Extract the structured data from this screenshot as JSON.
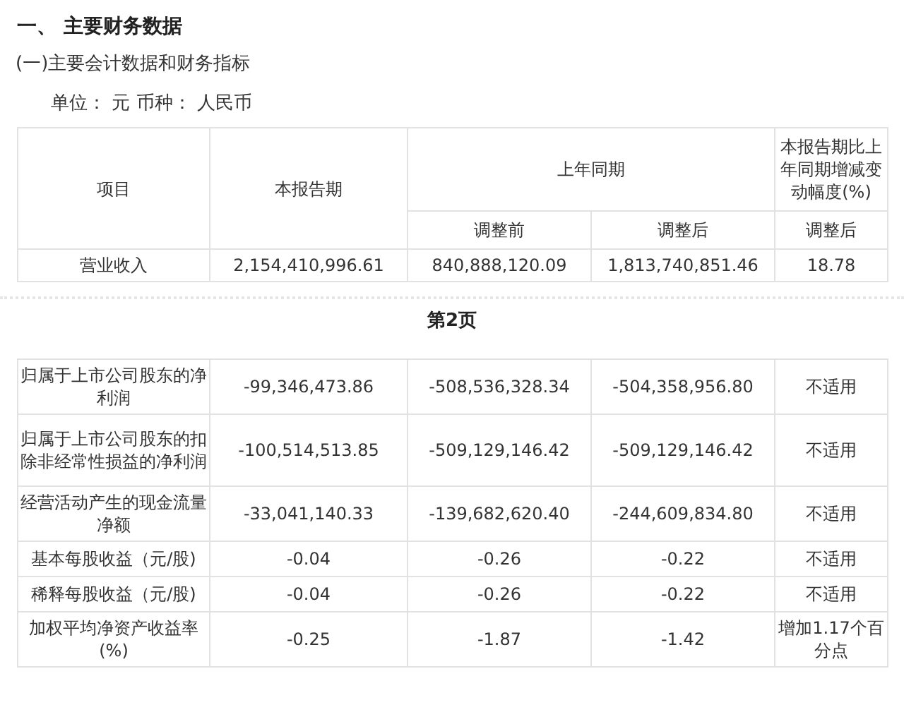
{
  "heading": "一、 主要财务数据",
  "subheading": "(一)主要会计数据和财务指标",
  "unit_line": "单位： 元 币种： 人民币",
  "table": {
    "header": {
      "item": "项目",
      "current": "本报告期",
      "prior_group": "上年同期",
      "change": "本报告期比上年同期增减变动幅度(%)",
      "before": "调整前",
      "after": "调整后",
      "change_after": "调整后"
    },
    "rows": [
      {
        "cells": [
          "营业收入",
          "2,154,410,996.61",
          "840,888,120.09",
          "1,813,740,851.46",
          "18.78"
        ]
      }
    ]
  },
  "page_label": "第2页",
  "table_2": {
    "rows": [
      {
        "cells": [
          "归属于上市公司股东的净利润",
          "-99,346,473.86",
          "-508,536,328.34",
          "-504,358,956.80",
          "不适用"
        ]
      },
      {
        "cells": [
          "归属于上市公司股东的扣除非经常性损益的净利润",
          "-100,514,513.85",
          "-509,129,146.42",
          "-509,129,146.42",
          "不适用"
        ]
      },
      {
        "cells": [
          "经营活动产生的现金流量净额",
          "-33,041,140.33",
          "-139,682,620.40",
          "-244,609,834.80",
          "不适用"
        ]
      },
      {
        "cells": [
          "基本每股收益（元/股)",
          "-0.04",
          "-0.26",
          "-0.22",
          "不适用"
        ]
      },
      {
        "cells": [
          "稀释每股收益（元/股)",
          "-0.04",
          "-0.26",
          "-0.22",
          "不适用"
        ]
      },
      {
        "cells": [
          "加权平均净资产收益率(%)",
          "-0.25",
          "-1.87",
          "-1.42",
          "增加1.17个百分点"
        ]
      }
    ]
  }
}
